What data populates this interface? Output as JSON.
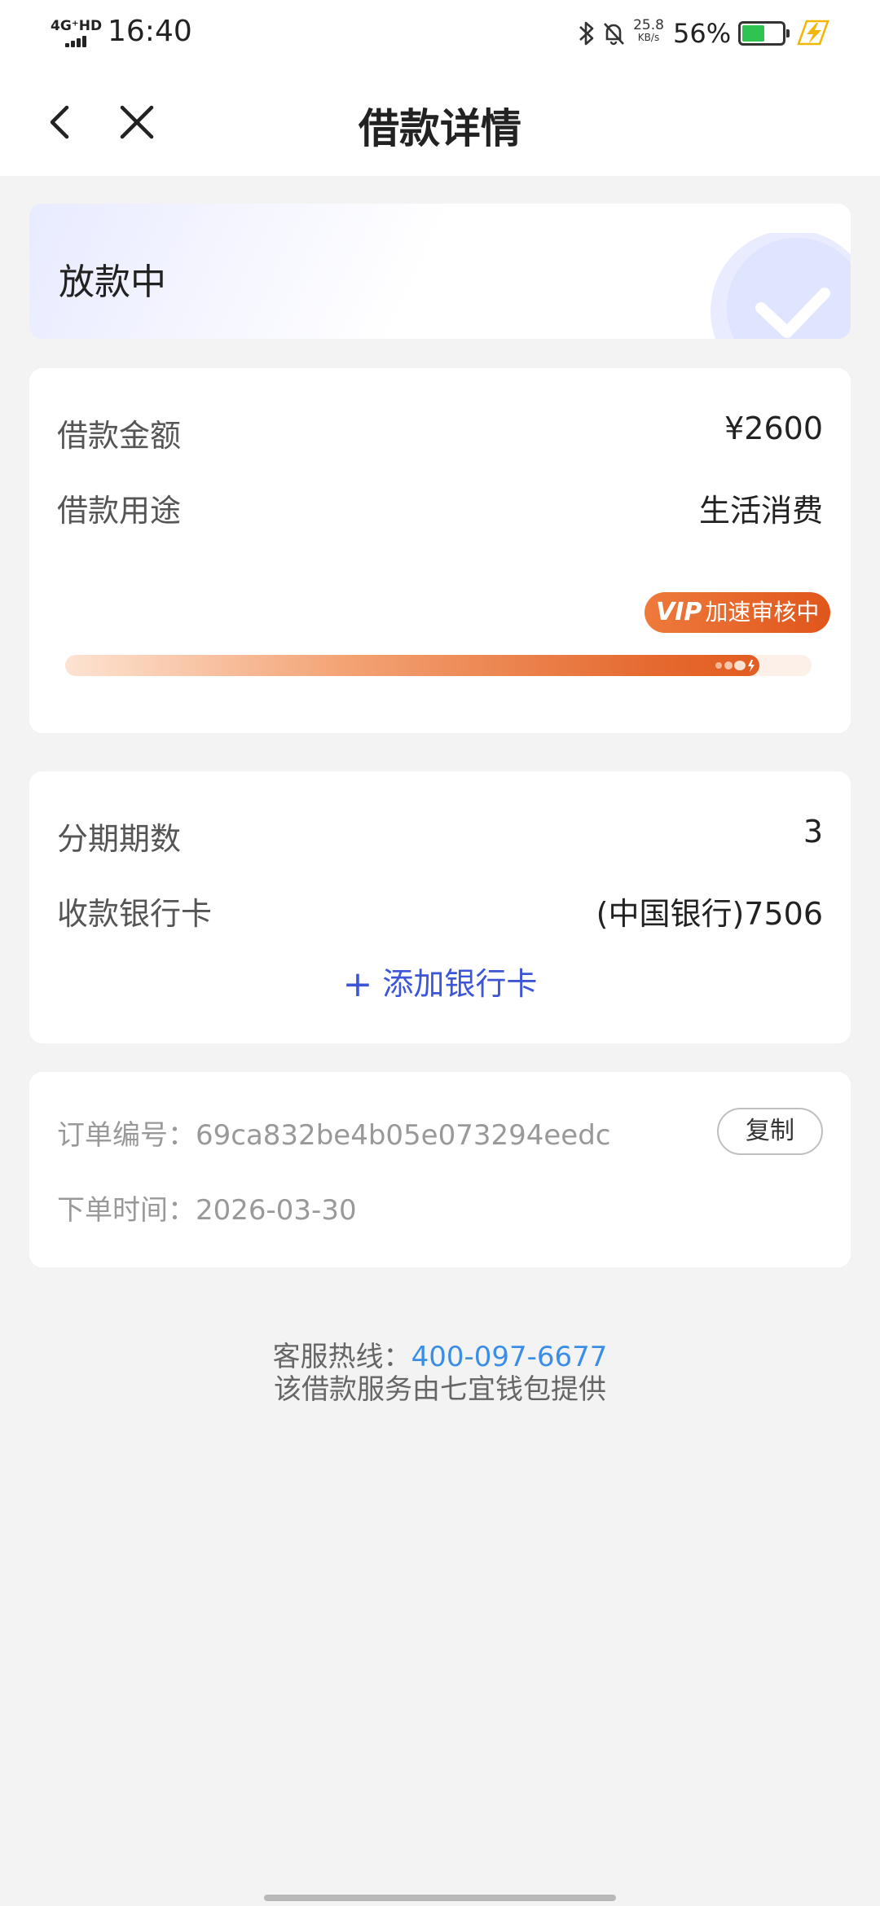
{
  "status_bar": {
    "network": "4G⁺HD",
    "time": "16:40",
    "speed_value": "25.8",
    "speed_unit": "KB/s",
    "battery_pct": "56%",
    "battery_level": 0.56
  },
  "nav": {
    "title": "借款详情"
  },
  "status": {
    "text": "放款中"
  },
  "loan": {
    "amount_label": "借款金额",
    "amount_value": "¥2600",
    "purpose_label": "借款用途",
    "purpose_value": "生活消费",
    "badge_vip": "VIP",
    "badge_text": "加速审核中",
    "progress": 0.93
  },
  "bank": {
    "installments_label": "分期期数",
    "installments_value": "3",
    "card_label": "收款银行卡",
    "card_value": "(中国银行)7506",
    "add_card_label": "添加银行卡"
  },
  "order": {
    "id_label": "订单编号：",
    "id_value": "69ca832be4b05e073294eedc",
    "copy_label": "复制",
    "time_label": "下单时间：",
    "time_value": "2026-03-30"
  },
  "footer": {
    "hotline_label": "客服热线：",
    "hotline_number": "400-097-6677",
    "provider_text": "该借款服务由七宜钱包提供"
  },
  "colors": {
    "accent_blue": "#3d55d7",
    "hotline_blue": "#3a8ee6",
    "progress_orange": "#e25d22",
    "battery_green": "#2fc451"
  }
}
